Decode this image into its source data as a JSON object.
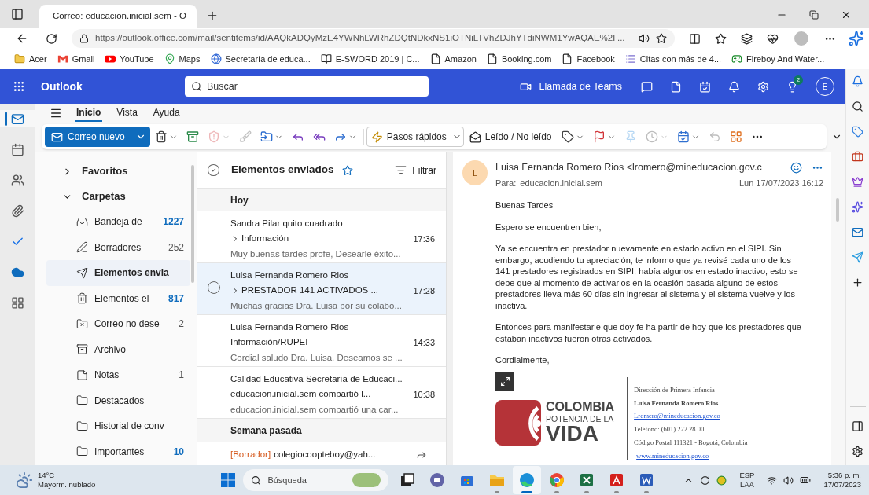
{
  "browser": {
    "tab_title": "Correo: educacion.inicial.sem - O",
    "url": "https://outlook.office.com/mail/sentitems/id/AAQkADQyMzE4YWNhLWRhZDQtNDkxNS1iOTNiLTVhZDJhYTdiNWM1YwAQAE%2F...",
    "bookmarks": [
      {
        "label": "Acer",
        "kind": "folder"
      },
      {
        "label": "Gmail",
        "kind": "gmail"
      },
      {
        "label": "YouTube",
        "kind": "youtube"
      },
      {
        "label": "Maps",
        "kind": "maps"
      },
      {
        "label": "Secretaría de educa...",
        "kind": "site"
      },
      {
        "label": "E-SWORD 2019 | C...",
        "kind": "book"
      },
      {
        "label": "Amazon",
        "kind": "page"
      },
      {
        "label": "Booking.com",
        "kind": "page"
      },
      {
        "label": "Facebook",
        "kind": "page"
      },
      {
        "label": "Citas con más de 4...",
        "kind": "list"
      },
      {
        "label": "Fireboy And Water...",
        "kind": "game"
      }
    ]
  },
  "outlook": {
    "app_name": "Outlook",
    "search_placeholder": "Buscar",
    "teams_call": "Llamada de Teams",
    "tips_badge": "2",
    "avatar": "E"
  },
  "rail": [
    {
      "kind": "mail",
      "selected": true
    },
    {
      "kind": "calendar",
      "selected": false
    },
    {
      "kind": "people",
      "selected": false
    },
    {
      "kind": "files",
      "selected": false
    },
    {
      "kind": "todo",
      "selected": false
    },
    {
      "kind": "onedrive",
      "selected": false
    },
    {
      "kind": "apps",
      "selected": false
    }
  ],
  "ribbon": {
    "tabs": [
      {
        "label": "Inicio",
        "selected": true
      },
      {
        "label": "Vista",
        "selected": false
      },
      {
        "label": "Ayuda",
        "selected": false
      }
    ],
    "new_mail": "Correo nuevo",
    "quick_steps": "Pasos rápidos",
    "read_unread": "Leído / No leído",
    "actions_left": [
      {
        "kind": "delete",
        "menu": true,
        "disabled": false
      },
      {
        "kind": "archive",
        "menu": false,
        "disabled": false
      },
      {
        "kind": "report",
        "menu": true,
        "disabled": true
      },
      {
        "kind": "sweep",
        "menu": false,
        "disabled": true
      },
      {
        "kind": "move",
        "menu": true,
        "disabled": false
      },
      {
        "kind": "reply",
        "menu": false,
        "disabled": false
      },
      {
        "kind": "replyall",
        "menu": false,
        "disabled": false
      },
      {
        "kind": "forward",
        "menu": true,
        "disabled": false
      }
    ],
    "actions_right": [
      {
        "kind": "tag",
        "menu": true,
        "disabled": false
      },
      {
        "kind": "flag",
        "menu": true,
        "disabled": false
      },
      {
        "kind": "pin",
        "menu": false,
        "disabled": true
      },
      {
        "kind": "snooze",
        "menu": true,
        "disabled": true
      },
      {
        "kind": "rules",
        "menu": true,
        "disabled": false
      },
      {
        "kind": "undo",
        "menu": false,
        "disabled": true
      },
      {
        "kind": "apps",
        "menu": false,
        "disabled": false
      },
      {
        "kind": "more",
        "menu": false,
        "disabled": false
      }
    ]
  },
  "folders": {
    "sections": [
      {
        "label": "Favoritos",
        "expanded": false
      },
      {
        "label": "Carpetas",
        "expanded": true,
        "items": [
          {
            "name": "Bandeja de",
            "kind": "inbox",
            "count": "1227",
            "unread": true,
            "selected": false
          },
          {
            "name": "Borradores",
            "kind": "drafts",
            "count": "252",
            "unread": false,
            "selected": false
          },
          {
            "name": "Elementos envia",
            "kind": "sent",
            "selected": true
          },
          {
            "name": "Elementos el",
            "kind": "deleted",
            "count": "817",
            "unread": true,
            "selected": false
          },
          {
            "name": "Correo no dese",
            "kind": "junk",
            "count": "2",
            "unread": false,
            "selected": false
          },
          {
            "name": "Archivo",
            "kind": "archive",
            "selected": false
          },
          {
            "name": "Notas",
            "kind": "notes",
            "count": "1",
            "unread": false,
            "selected": false
          },
          {
            "name": "Destacados",
            "kind": "folder",
            "selected": false
          },
          {
            "name": "Historial de conv",
            "kind": "folder",
            "selected": false
          },
          {
            "name": "Importantes",
            "kind": "folder",
            "count": "10",
            "unread": true,
            "selected": false
          }
        ]
      }
    ]
  },
  "message_list": {
    "title": "Elementos enviados",
    "filter": "Filtrar",
    "groups": [
      {
        "label": "Hoy",
        "messages": [
          {
            "sender": "Sandra Pilar quito cuadrado",
            "subject": "Información",
            "time": "17:36",
            "preview": "Muy buenas tardes profe, Desearle éxito...",
            "threaded": true,
            "selected": false,
            "forwarded": false
          },
          {
            "sender": "Luisa Fernanda Romero Rios",
            "subject": "PRESTADOR 141 ACTIVADOS ...",
            "time": "17:28",
            "preview": "Muchas gracias Dra. Luisa por su colabo...",
            "threaded": true,
            "selected": true,
            "forwarded": false
          },
          {
            "sender": "Luisa Fernanda Romero Rios",
            "subject": "Información/RUPEI",
            "time": "14:33",
            "preview": "Cordial saludo Dra. Luisa. Deseamos se ...",
            "threaded": false,
            "selected": false,
            "forwarded": false
          },
          {
            "sender": "Calidad Educativa Secretaría de Educaci...",
            "subject": "educacion.inicial.sem compartió l...",
            "time": "10:38",
            "preview": "educacion.inicial.sem compartió una car...",
            "threaded": false,
            "selected": false,
            "forwarded": false
          }
        ]
      },
      {
        "label": "Semana pasada",
        "messages": [
          {
            "draft_tag": "[Borrador]",
            "sender": "colegiocoopteboy@yah...",
            "selected": false,
            "forwarded": true
          }
        ]
      }
    ]
  },
  "reading": {
    "avatar": "L",
    "sender": "Luisa Fernanda Romero Rios <lromero@mineducacion.gov.c",
    "to_label": "Para:",
    "to": "educacion.inicial.sem",
    "date": "Lun 17/07/2023 16:12",
    "body": [
      "Buenas Tardes",
      "Espero se encuentren bien,",
      "Ya se encuentra en prestador nuevamente en estado activo en el SIPI. Sin embargo, acudiendo tu apreciación, te informo que ya revisé cada uno de los 141 prestadores registrados en SIPI, había algunos en estado inactivo, esto se debe que al momento de activarlos en la ocasión pasada alguno de estos prestadores lleva más 60 días sin ingresar al sistema y el sistema vuelve y los inactiva.",
      "Entonces para manifestarle que doy fe ha partir de hoy que los prestadores que estaban inactivos fueron otras activados.",
      "Cordialmente,"
    ],
    "signature": {
      "logo_line1": "COLOMBIA",
      "logo_line2": "POTENCIA DE LA",
      "logo_line3": "VIDA",
      "department": "Dirección de Primera Infancia",
      "name": "Luisa Fernanda Romero Rios",
      "email": "Lromero@mineducacion.gov.co",
      "phone": "Teléfono: (601) 222 28 00",
      "postal": "Código Postal 111321 - Bogotá, Colombia",
      "website": "www.mineducacion.gov.co"
    }
  },
  "taskbar": {
    "weather_temp": "14°C",
    "weather_text": "Mayorm. nublado",
    "search": "Búsqueda",
    "apps": [
      {
        "kind": "taskview",
        "running": false,
        "active": false
      },
      {
        "kind": "chat",
        "running": false,
        "active": false
      },
      {
        "kind": "store",
        "running": false,
        "active": false
      },
      {
        "kind": "explorer",
        "running": true,
        "active": false
      },
      {
        "kind": "edge",
        "running": true,
        "active": true
      },
      {
        "kind": "chrome",
        "running": true,
        "active": false
      },
      {
        "kind": "excel",
        "running": true,
        "active": false
      },
      {
        "kind": "acrobat",
        "running": true,
        "active": false
      },
      {
        "kind": "word",
        "running": true,
        "active": false
      }
    ],
    "language": "ESP",
    "layout": "LAA",
    "time": "5:36 p. m.",
    "date": "17/07/2023"
  }
}
